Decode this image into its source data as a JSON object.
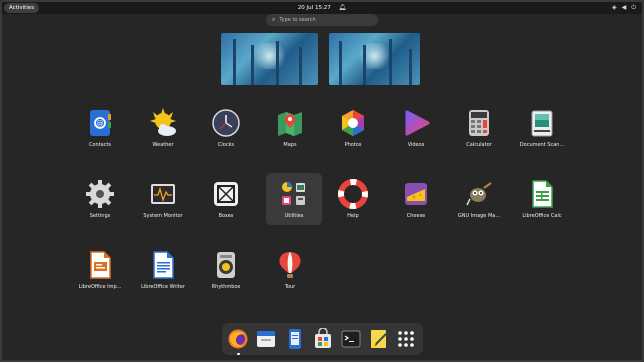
{
  "topbar": {
    "activities_label": "Activities",
    "clock": "20 Jul  15:27",
    "icons": [
      "notification-bell-icon",
      "network-icon",
      "volume-icon",
      "power-icon"
    ]
  },
  "search": {
    "placeholder": "Type to search"
  },
  "apps": [
    {
      "label": "Contacts",
      "icon": "contacts-icon"
    },
    {
      "label": "Weather",
      "icon": "weather-icon"
    },
    {
      "label": "Clocks",
      "icon": "clocks-icon"
    },
    {
      "label": "Maps",
      "icon": "maps-icon"
    },
    {
      "label": "Photos",
      "icon": "photos-icon"
    },
    {
      "label": "Videos",
      "icon": "videos-icon"
    },
    {
      "label": "Calculator",
      "icon": "calculator-icon"
    },
    {
      "label": "Document Scan...",
      "icon": "document-scanner-icon"
    },
    {
      "label": "Settings",
      "icon": "settings-icon"
    },
    {
      "label": "System Monitor",
      "icon": "system-monitor-icon"
    },
    {
      "label": "Boxes",
      "icon": "boxes-icon"
    },
    {
      "label": "Utilities",
      "icon": "utilities-folder-icon"
    },
    {
      "label": "Help",
      "icon": "help-icon"
    },
    {
      "label": "Cheese",
      "icon": "cheese-icon"
    },
    {
      "label": "GNU Image Ma...",
      "icon": "gimp-icon"
    },
    {
      "label": "LibreOffice Calc",
      "icon": "libreoffice-calc-icon"
    },
    {
      "label": "LibreOffice Imp...",
      "icon": "libreoffice-impress-icon"
    },
    {
      "label": "LibreOffice Writer",
      "icon": "libreoffice-writer-icon"
    },
    {
      "label": "Rhythmbox",
      "icon": "rhythmbox-icon"
    },
    {
      "label": "Tour",
      "icon": "tour-icon"
    }
  ],
  "dock": [
    {
      "icon": "firefox-icon"
    },
    {
      "icon": "calendar-icon"
    },
    {
      "icon": "notes-icon"
    },
    {
      "icon": "software-icon"
    },
    {
      "icon": "terminal-icon"
    },
    {
      "icon": "text-editor-icon"
    },
    {
      "icon": "show-apps-grid-icon"
    }
  ]
}
